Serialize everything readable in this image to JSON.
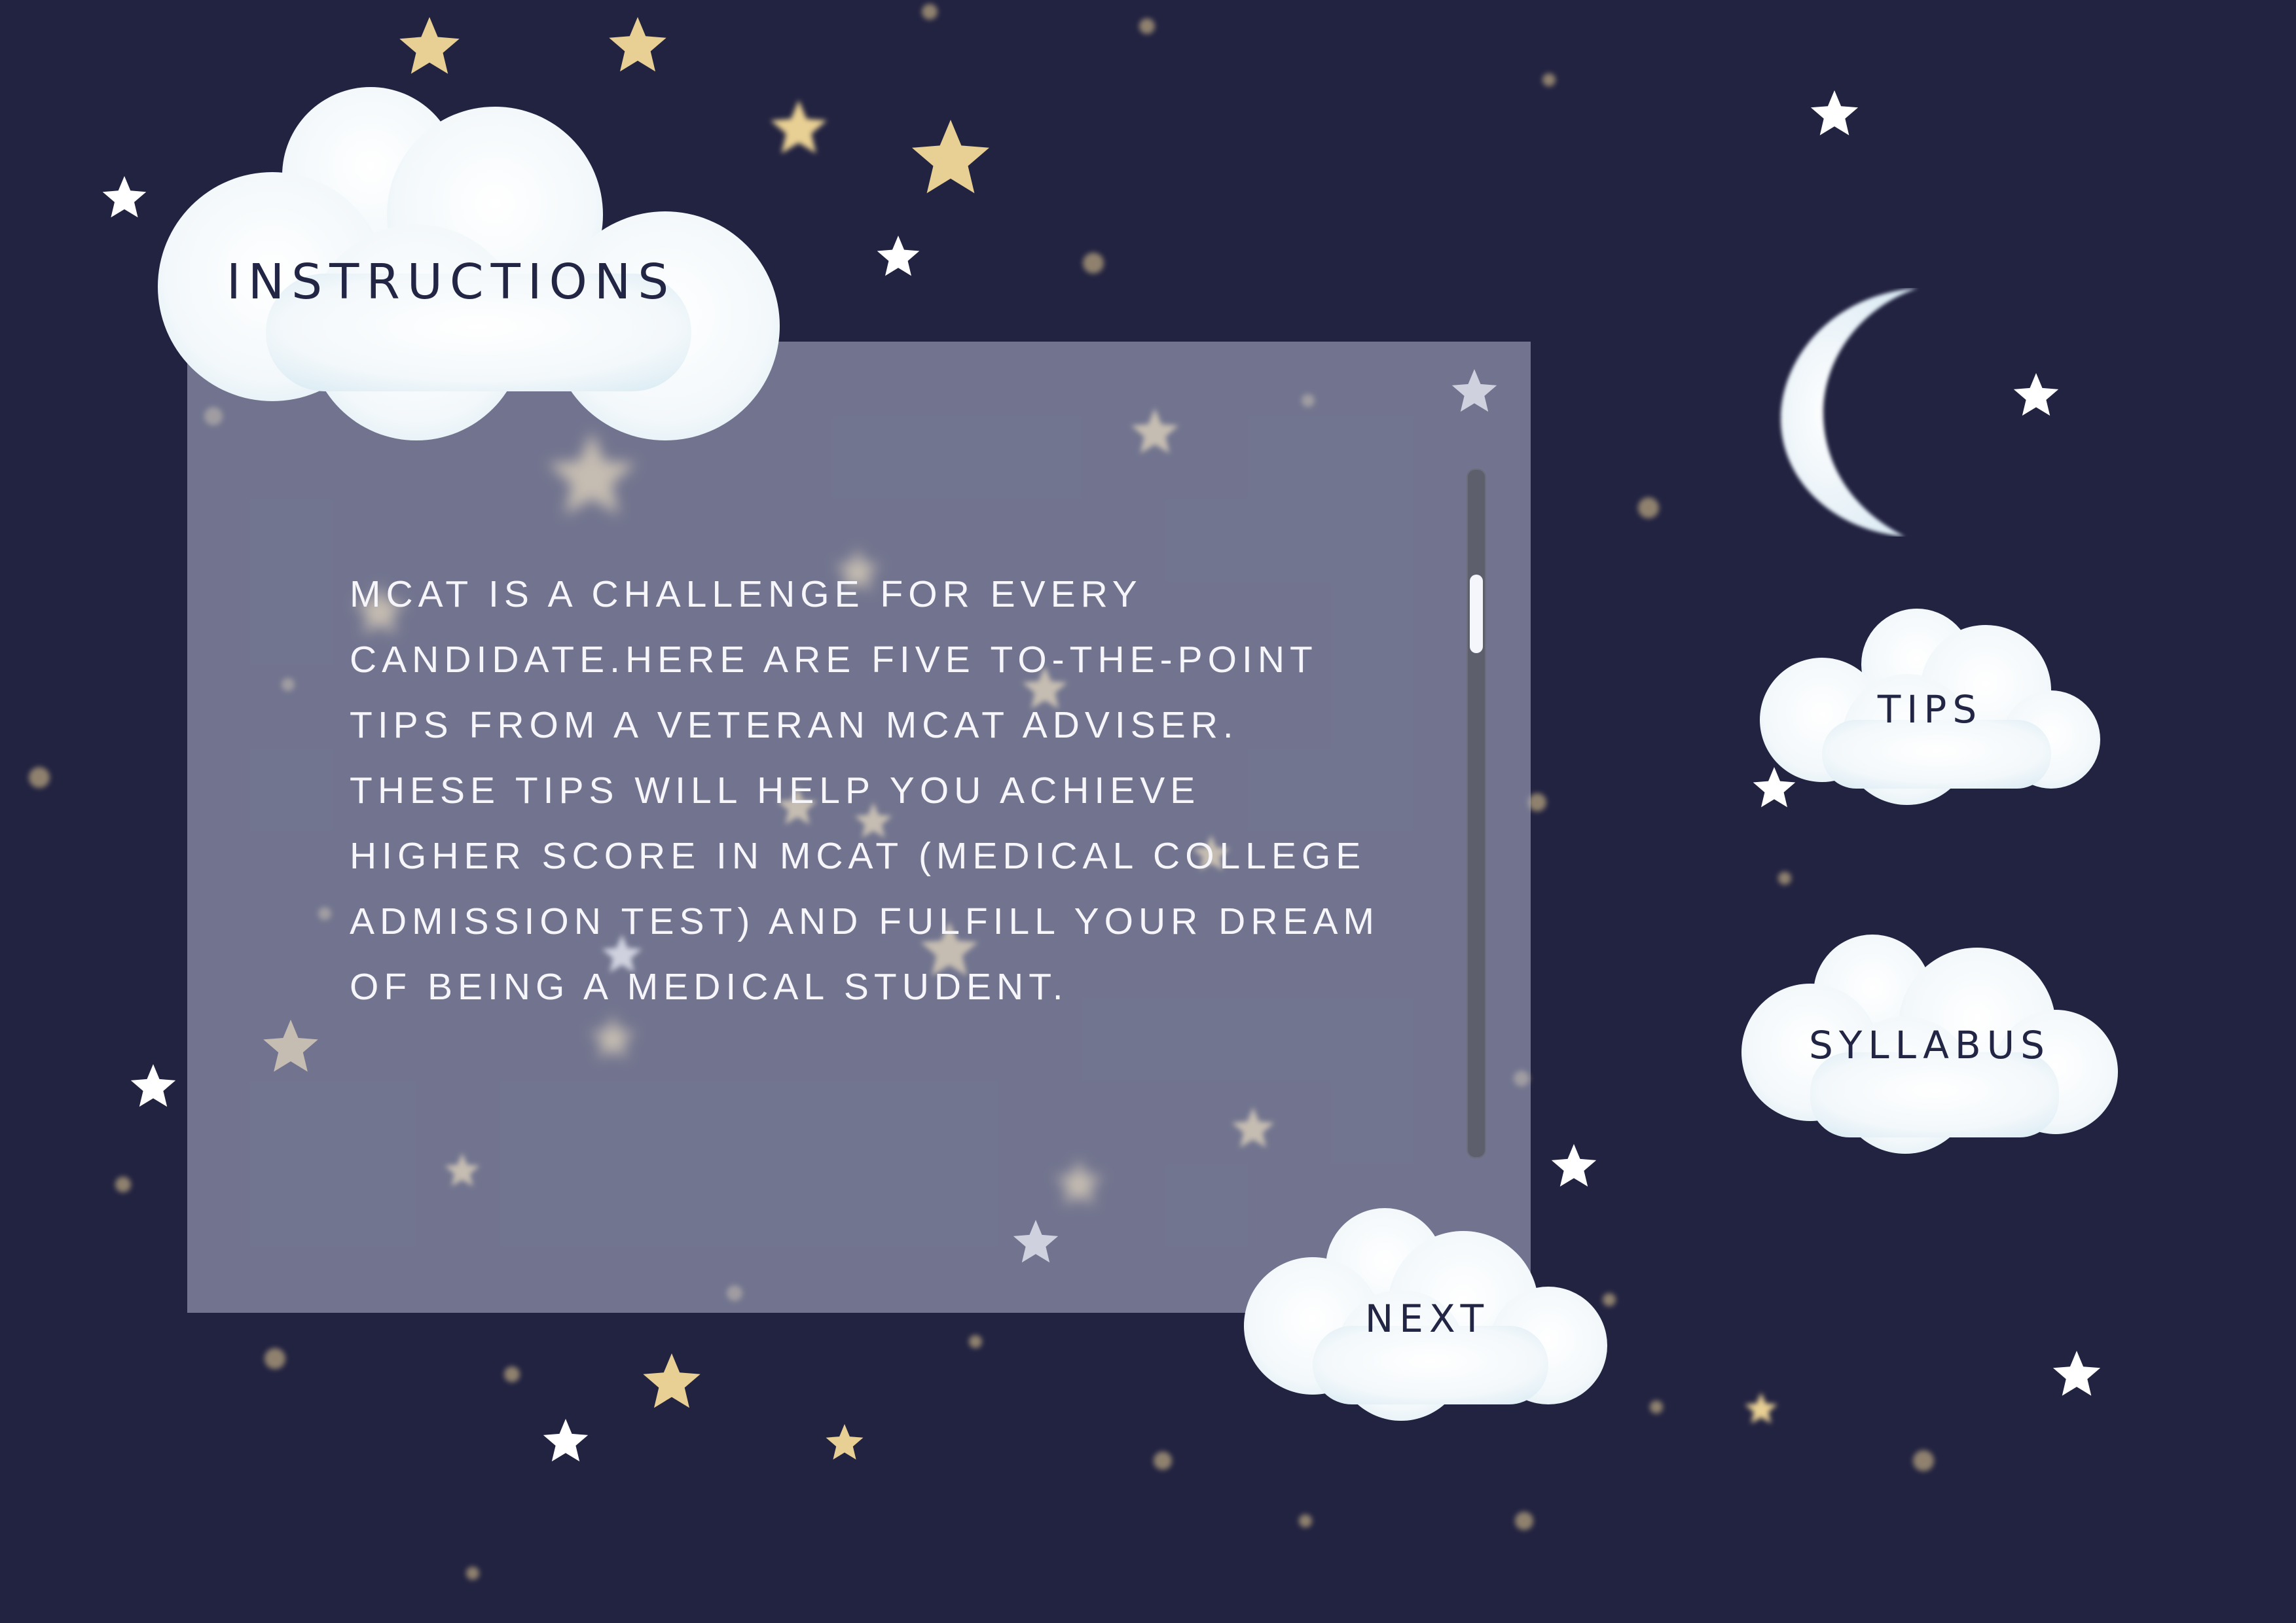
{
  "title": "INSTRUCTIONS",
  "body_text": "MCAT IS A CHALLENGE FOR EVERY\nCANDIDATE.HERE ARE FIVE TO-THE-POINT\n TIPS FROM A VETERAN MCAT ADVISER.\nTHESE TIPS WILL HELP YOU ACHIEVE\nHIGHER SCORE IN MCAT (MEDICAL COLLEGE\nADMISSION TEST) AND FULFILL YOUR DREAM\nOF BEING A MEDICAL STUDENT.",
  "nav": {
    "tips_label": "TIPS",
    "syllabus_label": "SYLLABUS",
    "next_label": "NEXT"
  },
  "icons": {
    "moon": "crescent-moon-icon",
    "stars": "star-icon",
    "clouds": "cloud-icon"
  },
  "colors": {
    "background": "#222341",
    "cloud": "#f2f8fb",
    "text_dark": "#232544",
    "star_gold": "#e8cf93",
    "star_white": "#ffffff"
  }
}
